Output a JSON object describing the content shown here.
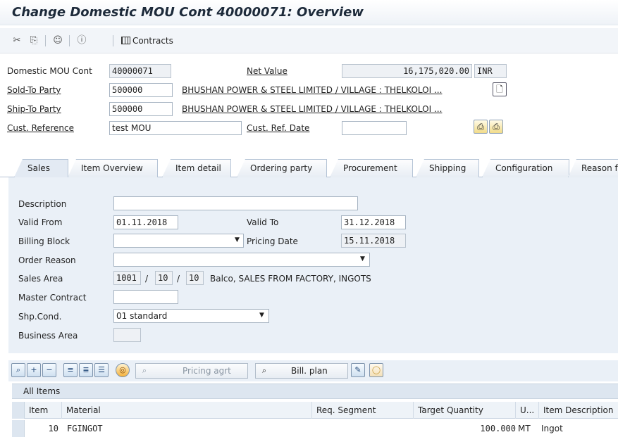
{
  "title": "Change Domestic MOU Cont 40000071: Overview",
  "toolbar": {
    "contracts_label": "Contracts"
  },
  "header": {
    "doc_label": "Domestic MOU Cont",
    "doc_value": "40000071",
    "net_value_label": "Net Value",
    "net_value": "16,175,020.00",
    "currency": "INR",
    "sold_to_label": "Sold-To Party",
    "sold_to_value": "500000",
    "sold_to_name": "BHUSHAN POWER & STEEL LIMITED / VILLAGE : THELKOLOI ...",
    "ship_to_label": "Ship-To Party",
    "ship_to_value": "500000",
    "ship_to_name": "BHUSHAN POWER & STEEL LIMITED / VILLAGE : THELKOLOI ...",
    "cust_ref_label": "Cust. Reference",
    "cust_ref_value": "test MOU",
    "cust_ref_date_label": "Cust. Ref. Date",
    "cust_ref_date_value": ""
  },
  "tabs": [
    {
      "label": "Sales",
      "active": true
    },
    {
      "label": "Item Overview"
    },
    {
      "label": "Item detail"
    },
    {
      "label": "Ordering party"
    },
    {
      "label": "Procurement"
    },
    {
      "label": "Shipping"
    },
    {
      "label": "Configuration"
    },
    {
      "label": "Reason f"
    }
  ],
  "sales": {
    "description_label": "Description",
    "description_value": "",
    "valid_from_label": "Valid From",
    "valid_from_value": "01.11.2018",
    "valid_to_label": "Valid To",
    "valid_to_value": "31.12.2018",
    "billing_block_label": "Billing Block",
    "billing_block_value": "",
    "pricing_date_label": "Pricing Date",
    "pricing_date_value": "15.11.2018",
    "order_reason_label": "Order Reason",
    "order_reason_value": "",
    "sales_area_label": "Sales Area",
    "sales_org": "1001",
    "dist_channel": "10",
    "division": "10",
    "sales_area_sep": "/",
    "sales_area_text": "Balco, SALES FROM FACTORY, INGOTS",
    "master_contract_label": "Master Contract",
    "master_contract_value": "",
    "shp_cond_label": "Shp.Cond.",
    "shp_cond_value": "01 standard",
    "business_area_label": "Business Area",
    "business_area_value": ""
  },
  "item_toolbar": {
    "pricing_agrt_label": "Pricing agrt",
    "bill_plan_label": "Bill. plan"
  },
  "items_table": {
    "title": "All Items",
    "columns": [
      "Item",
      "Material",
      "Req. Segment",
      "Target Quantity",
      "U...",
      "Item Description"
    ],
    "rows": [
      {
        "item": "10",
        "material": "FGINGOT",
        "req_segment": "",
        "target_qty": "100.000",
        "unit": "MT",
        "description": "Ingot"
      }
    ]
  }
}
